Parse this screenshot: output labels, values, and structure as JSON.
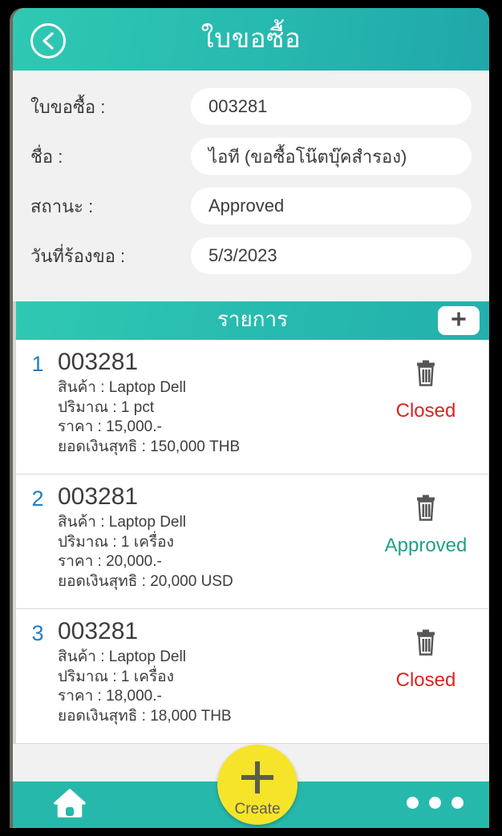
{
  "theme": {
    "teal": "#27bab0",
    "teal_dark": "#20a7a9",
    "panel_bg": "#f1f1f1",
    "index_blue": "#1f7fc0",
    "status_closed": "#dd2222",
    "status_approved": "#22a087",
    "fab_yellow": "#f5e42a",
    "icon_gray": "#4a4a4a"
  },
  "header": {
    "title": "ใบขอซื้อ",
    "back_icon": "chevron-left-icon"
  },
  "form": {
    "rows": [
      {
        "label": "ใบขอซื้อ :",
        "value": "003281"
      },
      {
        "label": "ชื่อ :",
        "value": "ไอที (ขอซื้อโน๊ตบุ๊คสำรอง)"
      },
      {
        "label": "สถานะ :",
        "value": "Approved"
      },
      {
        "label": "วันที่ร้องขอ :",
        "value": "5/3/2023"
      }
    ]
  },
  "items_section": {
    "title": "รายการ",
    "add_icon": "plus-icon",
    "items": [
      {
        "index": "1",
        "title": "003281",
        "product": "สินค้า : Laptop Dell",
        "quantity": "ปริมาณ : 1 pct",
        "price": "ราคา : 15,000.-",
        "net": "ยอดเงินสุทธิ : 150,000 THB",
        "status": "Closed",
        "status_color": "#dd2222",
        "delete_icon": "trash-icon"
      },
      {
        "index": "2",
        "title": "003281",
        "product": "สินค้า : Laptop Dell",
        "quantity": "ปริมาณ : 1 เครื่อง",
        "price": "ราคา : 20,000.-",
        "net": "ยอดเงินสุทธิ : 20,000 USD",
        "status": "Approved",
        "status_color": "#22a087",
        "delete_icon": "trash-icon"
      },
      {
        "index": "3",
        "title": "003281",
        "product": "สินค้า : Laptop Dell",
        "quantity": "ปริมาณ : 1 เครื่อง",
        "price": "ราคา : 18,000.-",
        "net": "ยอดเงินสุทธิ : 18,000 THB",
        "status": "Closed",
        "status_color": "#dd2222",
        "delete_icon": "trash-icon"
      }
    ]
  },
  "fab": {
    "label": "Create",
    "icon": "plus-icon"
  },
  "bottom_nav": {
    "home_icon": "home-icon",
    "more_icon": "more-dots-icon"
  }
}
